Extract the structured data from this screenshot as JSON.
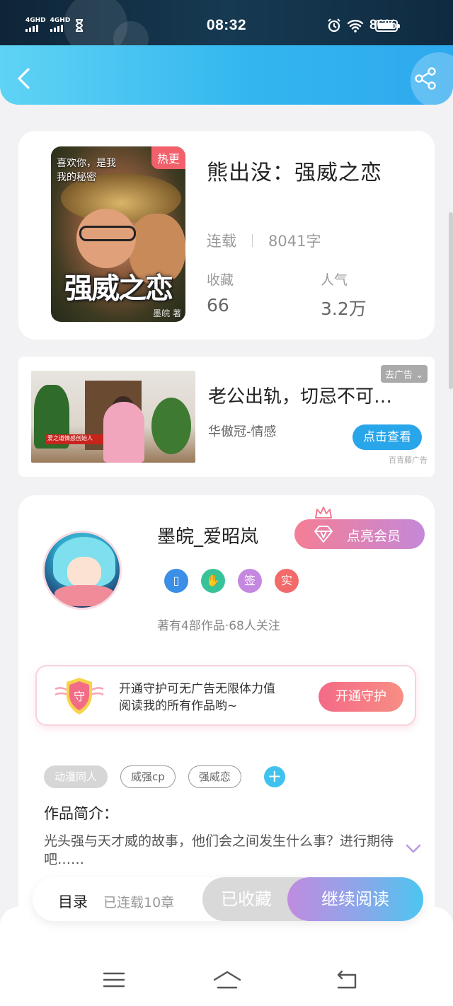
{
  "status_bar": {
    "net1": "4GHD",
    "net2": "4GHD",
    "time": "08:32",
    "battery": "86%"
  },
  "book": {
    "title": "熊出没：强威之恋",
    "hot_badge": "热更",
    "status": "连载",
    "word_count": "8041字",
    "stats": [
      {
        "label": "收藏",
        "value": "66"
      },
      {
        "label": "人气",
        "value": "3.2万"
      }
    ],
    "cover": {
      "caption_line1": "喜欢你，是我",
      "caption_line2": "我的秘密",
      "title": "强威之恋",
      "author_mark": "墨皖 著"
    }
  },
  "ad": {
    "title": "老公出轨，切忌不可…",
    "source": "华傲冠-情感",
    "close_label": "去广告",
    "cta": "点击查看",
    "brand": "百青藤广告",
    "thumb_banner": "爱之道情感创始人"
  },
  "author": {
    "name": "墨皖_爱昭岚",
    "vip_button": "点亮会员",
    "badges": [
      {
        "name": "phone-badge",
        "text": "",
        "color": "#3b8fe6"
      },
      {
        "name": "handshake-badge",
        "text": "",
        "color": "#37c39a"
      },
      {
        "name": "sign-badge",
        "text": "签",
        "color": "#c588e0"
      },
      {
        "name": "real-badge",
        "text": "实",
        "color": "#f26a6a"
      }
    ],
    "meta": "著有4部作品·68人关注",
    "guard": {
      "icon_text": "守",
      "line1": "开通守护可无广告无限体力值",
      "line2": "阅读我的所有作品哟~",
      "button": "开通守护"
    },
    "tags": [
      "动漫同人",
      "威强cp",
      "强威恋"
    ],
    "intro_label": "作品简介：",
    "intro_text": "光头强与天才威的故事，他们会之间发生什么事？进行期待吧……"
  },
  "action_bar": {
    "toc": "目录",
    "chapters": "已连载10章",
    "collected": "已收藏",
    "read": "继续阅读"
  },
  "colors": {
    "header": "#33b6ef",
    "accent_pink": "#f46a87",
    "accent_blue": "#29a5ea"
  }
}
